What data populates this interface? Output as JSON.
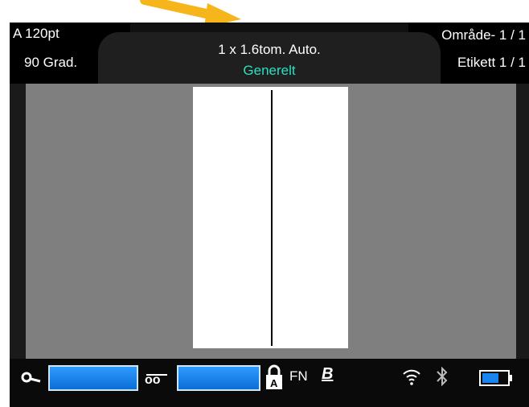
{
  "header": {
    "font_size": "A 120pt",
    "rotation": "90 Grad.",
    "label_size": "1 x 1.6tom. Auto.",
    "category": "Generelt",
    "area": "Område- 1 / 1",
    "label_count": "Etikett 1 / 1"
  },
  "status_bar": {
    "fn_label": "FN",
    "bold_label": "B",
    "icons": [
      "key-icon",
      "link-icon",
      "lock-icon",
      "bold-icon",
      "wifi-icon",
      "bluetooth-icon",
      "battery-icon"
    ]
  },
  "colors": {
    "accent_teal": "#29e0c2",
    "indicator_blue": "#1a85f0",
    "arrow_orange": "#f5b51b",
    "canvas_gray": "#7f7f7f"
  }
}
